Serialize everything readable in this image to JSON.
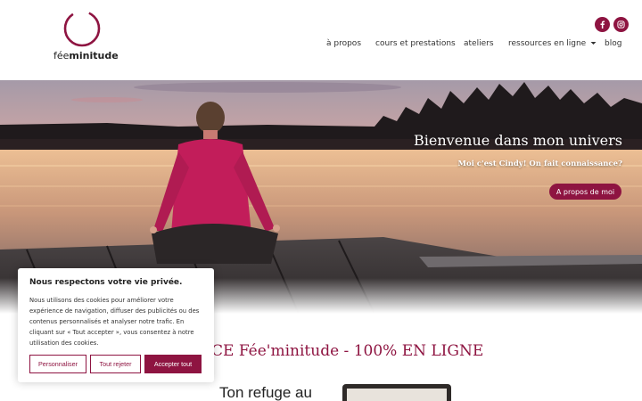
{
  "brand": {
    "logo_text_light": "fée",
    "logo_text_bold": "minitude",
    "accent": "#8e1441"
  },
  "social": [
    {
      "name": "facebook",
      "icon": "facebook-icon"
    },
    {
      "name": "instagram",
      "icon": "instagram-icon"
    }
  ],
  "nav": {
    "items": [
      "à propos",
      "cours et prestations",
      "ateliers",
      "ressources en ligne",
      "blog"
    ],
    "dropdown_icon": "caret-down-icon"
  },
  "hero": {
    "title": "Bienvenue dans mon univers",
    "subtitle": "Moi c'est Cindy! On fait connaissance?",
    "button_label": "A propos de moi"
  },
  "section": {
    "title": "CE Fée'minitude - 100% EN LIGNE",
    "subheading": "Ton refuge au"
  },
  "cookie": {
    "title": "Nous respectons votre vie privée.",
    "text": "Nous utilisons des cookies pour améliorer votre expérience de navigation, diffuser des publicités ou des contenus personnalisés et analyser notre trafic. En cliquant sur « Tout accepter », vous consentez à notre utilisation des cookies.",
    "customize_label": "Personnaliser",
    "reject_label": "Tout rejeter",
    "accept_label": "Accepter tout"
  }
}
